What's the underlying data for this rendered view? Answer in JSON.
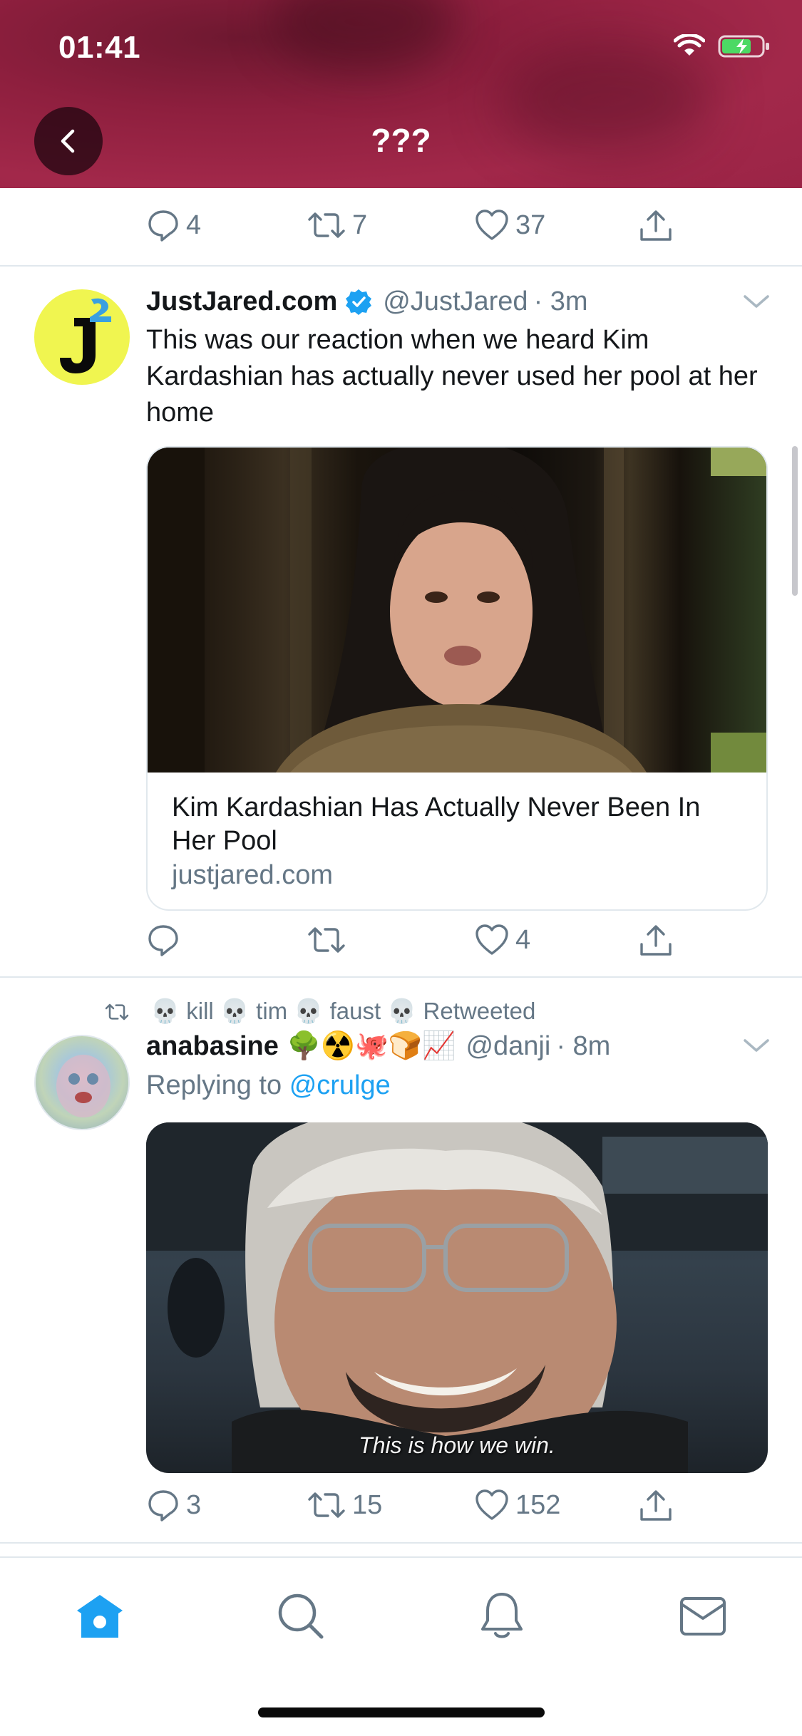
{
  "status_bar": {
    "time": "01:41"
  },
  "header": {
    "title": "???"
  },
  "top_actions": {
    "replies": "4",
    "retweets": "7",
    "likes": "37"
  },
  "tweet1": {
    "name": "JustJared.com",
    "handle": "@JustJared",
    "time": "· 3m",
    "text": "This was our reaction when we heard Kim Kardashian has actually never used her pool at her home",
    "card_title": "Kim Kardashian Has Actually Never Been In Her Pool",
    "card_domain": "justjared.com",
    "replies": "",
    "retweets": "",
    "likes": "4"
  },
  "tweet2": {
    "retweeted_by": "💀 kill 💀 tim 💀 faust 💀 Retweeted",
    "name": "anabasine",
    "name_emoji": "🌳☢️🐙🍞📈",
    "handle": "@danji",
    "time": "· 8m",
    "replying_prefix": "Replying to",
    "replying_to": "@crulge",
    "media_caption": "This is how we win.",
    "replies": "3",
    "retweets": "15",
    "likes": "152"
  },
  "colors": {
    "header": "#9b2446",
    "accent": "#1da1f2",
    "muted": "#657786"
  },
  "tabs": [
    "home-icon",
    "search-icon",
    "bell-icon",
    "mail-icon"
  ]
}
